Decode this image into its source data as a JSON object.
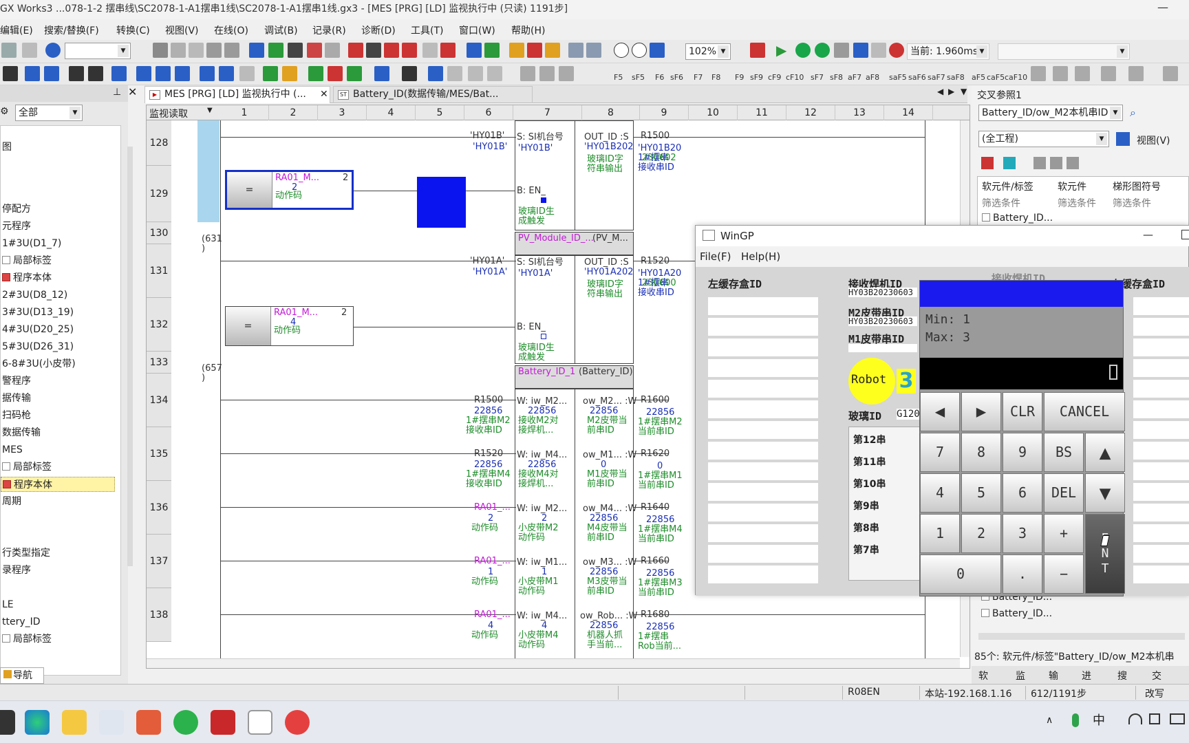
{
  "window": {
    "title": "GX Works3 ...078-1-2 摆串线\\SC2078-1-A1摆串1线\\SC2078-1-A1摆串1线.gx3 - [MES [PRG] [LD] 监视执行中 (只读) 1191步]",
    "minimize": "—"
  },
  "menu": [
    "编辑(E)",
    "搜索/替换(F)",
    "转换(C)",
    "视图(V)",
    "在线(O)",
    "调试(B)",
    "记录(R)",
    "诊断(D)",
    "工具(T)",
    "窗口(W)",
    "帮助(H)"
  ],
  "toolbar": {
    "zoom": "102%",
    "current_time": "当前: 1.960ms",
    "row3_labels": [
      "F5",
      "sF5",
      "F6",
      "sF6",
      "F7",
      "F8",
      "F9",
      "sF9",
      "cF9",
      "cF10",
      "sF7",
      "sF8",
      "aF7",
      "aF8",
      "saF5",
      "saF6",
      "saF7",
      "saF8",
      "aF5",
      "caF5",
      "caF10"
    ]
  },
  "left_pane": {
    "filter": "全部",
    "items": [
      "图",
      "停配方",
      "元程序",
      "1#3U(D1_7)",
      "局部标签",
      "程序本体",
      "2#3U(D8_12)",
      "3#3U(D13_19)",
      "4#3U(D20_25)",
      "5#3U(D26_31)",
      "6-8#3U(小皮带)",
      "警程序",
      "据传输",
      "扫码枪",
      "数据传输",
      "MES",
      "局部标签",
      "程序本体",
      "周期",
      "行类型指定",
      "录程序",
      "",
      "LE",
      "ttery_ID",
      "局部标签"
    ],
    "selected_index": 17,
    "nav_tab": "导航"
  },
  "tabs": [
    {
      "label": "MES [PRG] [LD] 监视执行中 (...",
      "icon": "PRG"
    },
    {
      "label": "Battery_ID(数据传输/MES/Bat...",
      "icon": "ST"
    }
  ],
  "ladder": {
    "header_label": "监视读取",
    "columns": [
      "1",
      "2",
      "3",
      "4",
      "5",
      "6",
      "7",
      "8",
      "9",
      "10",
      "11",
      "12",
      "13",
      "14"
    ],
    "rows": [
      "128",
      "129",
      "130",
      "131",
      "132",
      "133",
      "134",
      "135",
      "136",
      "137",
      "138"
    ],
    "row_notes": {
      "r130": "(631\n)",
      "r133": "(657\n)"
    },
    "r128": {
      "contact": "'HY01B'",
      "contact_val": "'HY01B'",
      "in_pin": "S: SI机台号",
      "in_val": "'HY01B'",
      "out_pin": "OUT_ID :S",
      "out_val": "'HY01B202",
      "out_cmt": "玻璃ID字\n符串输出",
      "dst": "R1500",
      "dst_val": "'HY01B20\n1#摆串\n接收串ID",
      "dst_over": "230602"
    },
    "r129": {
      "cmp_var": "RA01_M...",
      "cmp_val": "2",
      "cmp_const": "2",
      "cmp_cmt": "动作码",
      "cmp_op": "=",
      "en": "B: EN_",
      "en_cmt": "玻璃ID生\n成触发"
    },
    "r130": {
      "fb": "PV_Module_ID_...",
      "fb_type": "(PV_M..."
    },
    "r131": {
      "contact": "'HY01A'",
      "contact_val": "'HY01A'",
      "in_pin": "S: SI机台号",
      "in_val": "'HY01A'",
      "out_pin": "OUT_ID :S",
      "out_val": "'HY01A202",
      "out_cmt": "玻璃ID字\n符串输出",
      "dst": "R1520",
      "dst_val": "'HY01A20\n1#摆串\n接收串ID",
      "dst_over": "230600"
    },
    "r132": {
      "cmp_var": "RA01_M...",
      "cmp_val": "4",
      "cmp_const": "2",
      "cmp_cmt": "动作码",
      "cmp_op": "=",
      "en": "B: EN_",
      "en_cmt": "玻璃ID生\n成触发"
    },
    "r133": {
      "fb": "Battery_ID_1",
      "fb_type": "(Battery_ID)"
    },
    "r134": {
      "src": "R1500",
      "src_val": "22856",
      "src_cmt": "1#摆串M2\n接收串ID",
      "in_pin": "W: iw_M2...",
      "in_val": "22856",
      "in_cmt": "接收M2对\n接焊机...",
      "out_pin": "ow_M2... :W",
      "out_val": "22856",
      "out_cmt": "M2皮带当\n前串ID",
      "dst": "R1600",
      "dst_val": "22856",
      "dst_cmt": "1#摆串M2\n当前串ID"
    },
    "r135": {
      "src": "R1520",
      "src_val": "22856",
      "src_cmt": "1#摆串M4\n接收串ID",
      "in_pin": "W: iw_M4...",
      "in_val": "22856",
      "in_cmt": "接收M4对\n接焊机...",
      "out_pin": "ow_M1... :W",
      "out_val": "0",
      "out_cmt": "M1皮带当\n前串ID",
      "dst": "R1620",
      "dst_val": "0",
      "dst_cmt": "1#摆串M1\n当前串ID"
    },
    "r136": {
      "src": "RA01_...",
      "src_val": "2",
      "src_cmt": "动作码",
      "in_pin": "W: iw_M2...",
      "in_val": "2",
      "in_cmt": "小皮带M2\n动作码",
      "out_pin": "ow_M4... :W",
      "out_val": "22856",
      "out_cmt": "M4皮带当\n前串ID",
      "dst": "R1640",
      "dst_val": "22856",
      "dst_cmt": "1#摆串M4\n当前串ID"
    },
    "r137": {
      "src": "RA01_...",
      "src_val": "1",
      "src_cmt": "动作码",
      "in_pin": "W: iw_M1...",
      "in_val": "1",
      "in_cmt": "小皮带M1\n动作码",
      "out_pin": "ow_M3... :W",
      "out_val": "22856",
      "out_cmt": "M3皮带当\n前串ID",
      "dst": "R1660",
      "dst_val": "22856",
      "dst_cmt": "1#摆串M3\n当前串ID"
    },
    "r138": {
      "src": "RA01_...",
      "src_val": "4",
      "src_cmt": "动作码",
      "in_pin": "W: iw_M4...",
      "in_val": "4",
      "in_cmt": "小皮带M4\n动作码",
      "out_pin": "ow_Rob... :W",
      "out_val": "22856",
      "out_cmt": "机器人抓\n手当前...",
      "dst": "R1680",
      "dst_val": "22856",
      "dst_cmt": "1#摆串\nRob当前..."
    }
  },
  "right_pane": {
    "title": "交叉参照1",
    "search": "Battery_ID/ow_M2本机串ID",
    "scope": "(全工程)",
    "view": "视图(V)",
    "cols": [
      "软元件/标签",
      "软元件",
      "梯形图符号"
    ],
    "filter": "筛选条件",
    "rows": [
      "Battery_ID...",
      "Battery_ID...",
      "Battery_ID..."
    ],
    "status": "85个: 软元件/标签\"Battery_ID/ow_M2本机串",
    "bottom_tabs": [
      "软",
      "监",
      "输",
      "进",
      "搜",
      "交"
    ]
  },
  "wingp": {
    "title": "WinGP",
    "menu": [
      "File(F)",
      "Help(H)"
    ],
    "left_label": "左缓存盒ID",
    "recv_label": "接收焊机ID",
    "recv_val": "HY03B20230603",
    "m2_label": "M2皮带串ID",
    "m2_val": "HY03B20230603",
    "m1_label": "M1皮带串ID",
    "right_label": "右缓存盒ID",
    "recv2_label": "接收焊机ID",
    "robot": "Robot",
    "robot_num": "3",
    "glass_label": "玻璃ID",
    "glass_val": "G120",
    "strings": [
      "第12串",
      "第11串",
      "第10串",
      "第9串",
      "第8串",
      "第7串"
    ]
  },
  "keypad": {
    "min": "Min: 1",
    "max": "Max: 3",
    "display": "",
    "keys": {
      "left": "◀",
      "right": "▶",
      "clr": "CLR",
      "cancel": "CANCEL",
      "k7": "7",
      "k8": "8",
      "k9": "9",
      "bs": "BS",
      "up": "▲",
      "k4": "4",
      "k5": "5",
      "k6": "6",
      "del": "DEL",
      "down": "▼",
      "k1": "1",
      "k2": "2",
      "k3": "3",
      "plus": "+",
      "ent": "E\nN\nT",
      "k0": "0",
      "dot": ".",
      "minus": "−"
    }
  },
  "statusbar": {
    "plc": "R08EN",
    "station": "本站-192.168.1.16",
    "steps": "612/1191步",
    "mode": "改写"
  },
  "taskbar": {
    "lang": "中",
    "colors": {
      "accent": "#1f6fd8"
    }
  }
}
